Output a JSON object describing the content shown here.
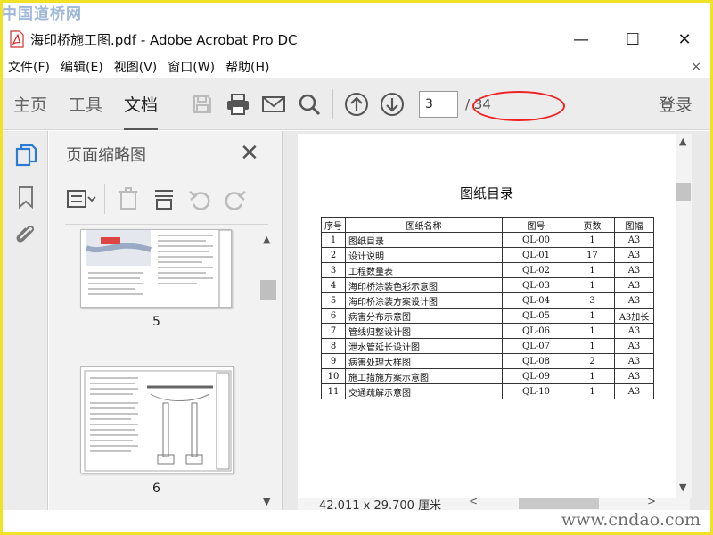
{
  "watermark": {
    "top": "中国道桥网",
    "bottom": "www.cndao.com"
  },
  "window": {
    "title": "海印桥施工图.pdf - Adobe Acrobat Pro DC",
    "controls": {
      "minimize": "—",
      "maximize": "☐",
      "close": "✕"
    }
  },
  "menu": {
    "items": [
      "文件(F)",
      "编辑(E)",
      "视图(V)",
      "窗口(W)",
      "帮助(H)"
    ],
    "close": "×"
  },
  "toolbar": {
    "tabs": [
      "主页",
      "工具",
      "文档"
    ],
    "active_tab": "文档",
    "current_page": "3",
    "total_pages": "/ 34",
    "login": "登录"
  },
  "thumbnail_panel": {
    "title": "页面缩略图",
    "close": "✕",
    "thumbnails": [
      {
        "label": "5"
      },
      {
        "label": "6"
      }
    ]
  },
  "document": {
    "page_title": "图纸目录",
    "table": {
      "headers": [
        "序号",
        "图纸名称",
        "图号",
        "页数",
        "图幅"
      ],
      "rows": [
        [
          "1",
          "图纸目录",
          "QL-00",
          "1",
          "A3"
        ],
        [
          "2",
          "设计说明",
          "QL-01",
          "17",
          "A3"
        ],
        [
          "3",
          "工程数量表",
          "QL-02",
          "1",
          "A3"
        ],
        [
          "4",
          "海印桥涂装色彩示意图",
          "QL-03",
          "1",
          "A3"
        ],
        [
          "5",
          "海印桥涂装方案设计图",
          "QL-04",
          "3",
          "A3"
        ],
        [
          "6",
          "病害分布示意图",
          "QL-05",
          "1",
          "A3加长"
        ],
        [
          "7",
          "管线归整设计图",
          "QL-06",
          "1",
          "A3"
        ],
        [
          "8",
          "泄水管延长设计图",
          "QL-07",
          "1",
          "A3"
        ],
        [
          "9",
          "病害处理大样图",
          "QL-08",
          "2",
          "A3"
        ],
        [
          "10",
          "施工措施方案示意图",
          "QL-09",
          "1",
          "A3"
        ],
        [
          "11",
          "交通疏解示意图",
          "QL-10",
          "1",
          "A3"
        ]
      ]
    },
    "page_size": "42.011 x 29.700 厘米"
  },
  "colors": {
    "frame": "#f2e227",
    "highlight_ellipse": "#e22222",
    "toolbar_bg": "#ececec"
  }
}
